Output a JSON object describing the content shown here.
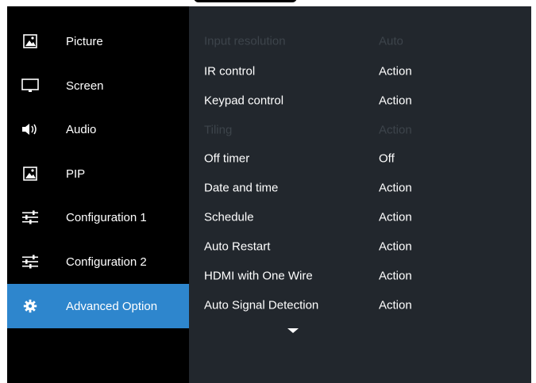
{
  "sidebar": {
    "items": [
      {
        "label": "Picture",
        "icon": "picture-icon"
      },
      {
        "label": "Screen",
        "icon": "monitor-icon"
      },
      {
        "label": "Audio",
        "icon": "speaker-icon"
      },
      {
        "label": "PIP",
        "icon": "picture-icon"
      },
      {
        "label": "Configuration 1",
        "icon": "sliders-icon"
      },
      {
        "label": "Configuration 2",
        "icon": "sliders-icon"
      },
      {
        "label": "Advanced Option",
        "icon": "gear-icon"
      }
    ],
    "active_index": 6
  },
  "options": [
    {
      "name": "Input resolution",
      "value": "Auto",
      "disabled": true
    },
    {
      "name": "IR control",
      "value": "Action",
      "disabled": false
    },
    {
      "name": "Keypad control",
      "value": "Action",
      "disabled": false
    },
    {
      "name": "Tiling",
      "value": "Action",
      "disabled": true
    },
    {
      "name": "Off timer",
      "value": "Off",
      "disabled": false
    },
    {
      "name": "Date and time",
      "value": "Action",
      "disabled": false
    },
    {
      "name": "Schedule",
      "value": "Action",
      "disabled": false
    },
    {
      "name": "Auto Restart",
      "value": "Action",
      "disabled": false
    },
    {
      "name": "HDMI with One Wire",
      "value": "Action",
      "disabled": false
    },
    {
      "name": "Auto Signal Detection",
      "value": "Action",
      "disabled": false
    }
  ],
  "more_indicator": "chevron-down-icon",
  "colors": {
    "background": "#000000",
    "content_panel": "#22272d",
    "accent": "#2e86cd",
    "text": "#ffffff",
    "disabled_text": "#3d444b"
  }
}
